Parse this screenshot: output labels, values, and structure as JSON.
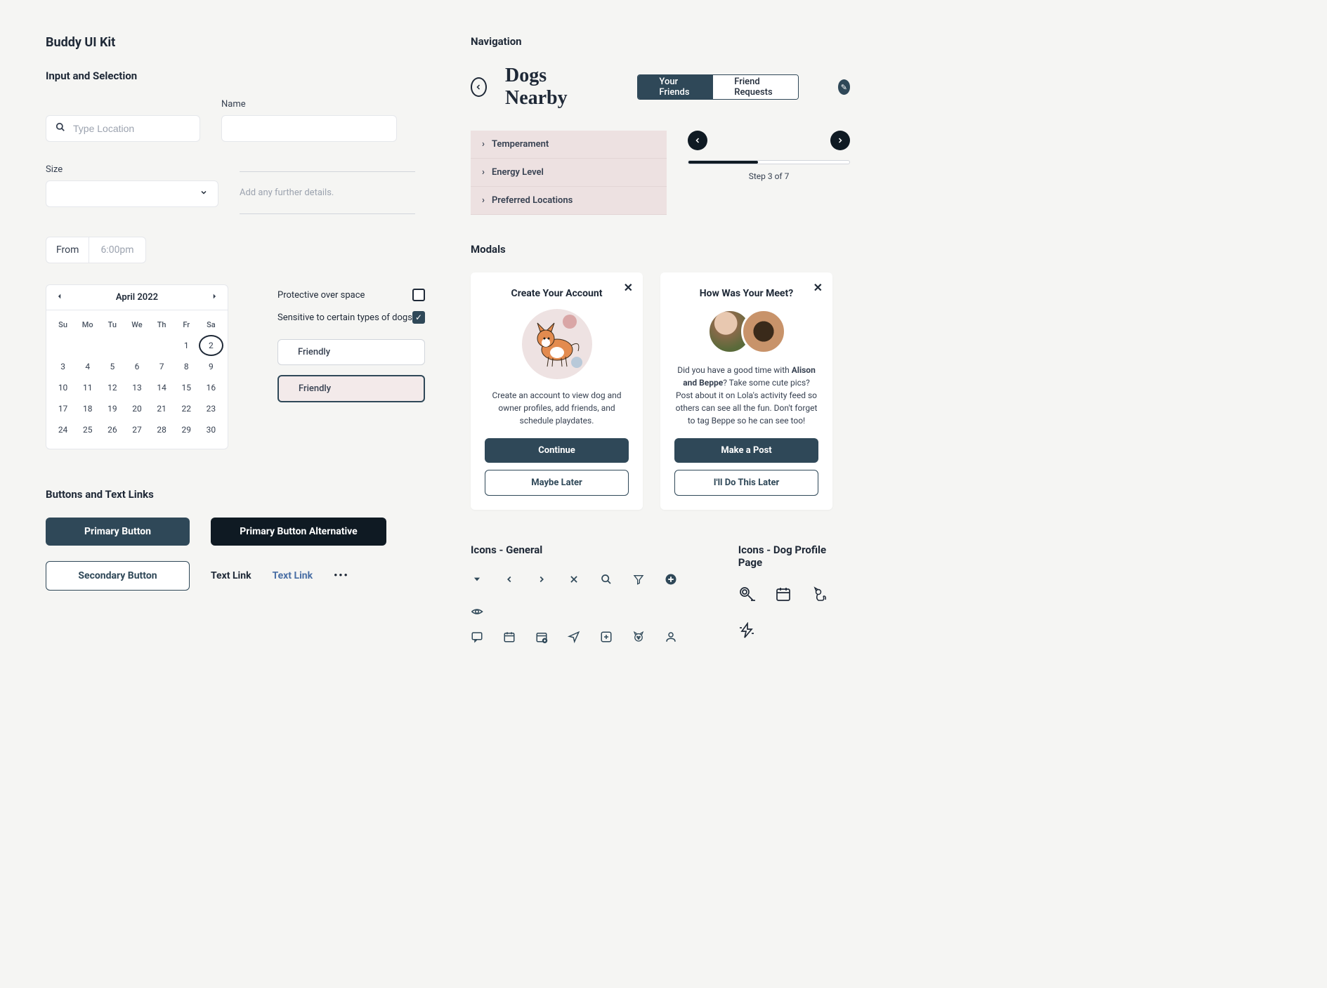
{
  "page_title": "Buddy UI Kit",
  "sections": {
    "input": "Input and Selection",
    "buttons": "Buttons and Text Links",
    "navigation": "Navigation",
    "modals": "Modals",
    "icons_general": "Icons - General",
    "icons_dog": "Icons - Dog Profile Page"
  },
  "inputs": {
    "location_placeholder": "Type Location",
    "name_label": "Name",
    "size_label": "Size",
    "from_label": "From",
    "from_value": "6:00pm",
    "details_placeholder": "Add any further details."
  },
  "calendar": {
    "month_year": "April 2022",
    "dows": [
      "Su",
      "Mo",
      "Tu",
      "We",
      "Th",
      "Fr",
      "Sa"
    ],
    "leading_empty": 5,
    "days": [
      1,
      2,
      3,
      4,
      5,
      6,
      7,
      8,
      9,
      10,
      11,
      12,
      13,
      14,
      15,
      16,
      17,
      18,
      19,
      20,
      21,
      22,
      23,
      24,
      25,
      26,
      27,
      28,
      29,
      30
    ],
    "selected_day": 2
  },
  "checkboxes": {
    "protective": "Protective over space",
    "sensitive": "Sensitive to certain types of dogs"
  },
  "pills": {
    "friendly": "Friendly"
  },
  "buttons": {
    "primary": "Primary Button",
    "primary_alt": "Primary Button Alternative",
    "secondary": "Secondary Button",
    "text_link": "Text Link",
    "text_link_blue": "Text Link"
  },
  "nav": {
    "title": "Dogs Nearby",
    "tabs": [
      "Your Friends",
      "Friend Requests"
    ],
    "accordion": [
      "Temperament",
      "Energy Level",
      "Preferred Locations"
    ],
    "step_label": "Step 3 of 7"
  },
  "modals": {
    "create": {
      "title": "Create Your Account",
      "body": "Create an account to view dog and owner profiles, add friends, and schedule playdates.",
      "primary": "Continue",
      "secondary": "Maybe Later"
    },
    "meet": {
      "title": "How Was Your Meet?",
      "body_pre": "Did you have a good time with ",
      "names": "Alison and Beppe",
      "body_post": "? Take some cute pics? Post about it on Lola's activity feed so others can see all the fun. Don't forget to tag Beppe so he can see too!",
      "primary": "Make a Post",
      "secondary": "I'll Do This Later"
    }
  }
}
